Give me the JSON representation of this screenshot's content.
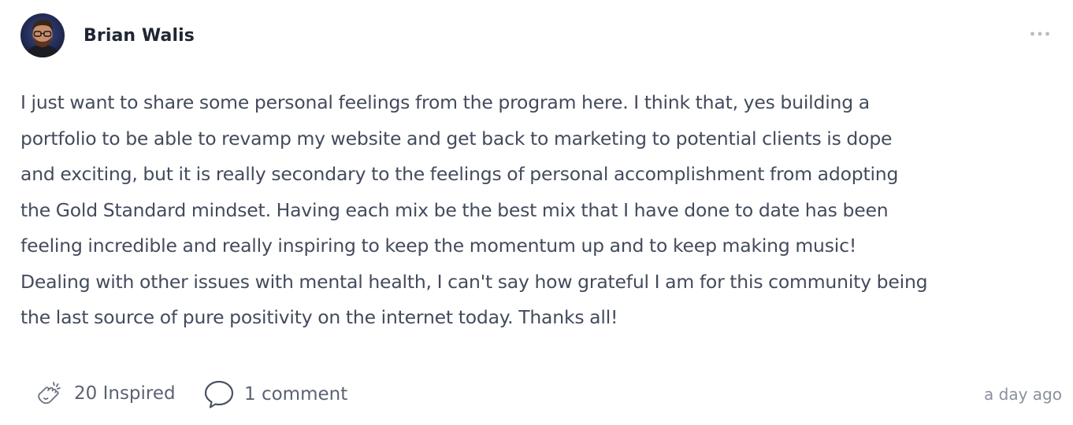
{
  "post": {
    "author": {
      "name": "Brian Walis",
      "avatar_icon": "user-avatar-photo"
    },
    "menu_icon": "more-horizontal-icon",
    "body_lines": [
      "I just want to share some personal feelings from the program here. I think that, yes building a",
      "portfolio to be able to revamp my website and get back to marketing to potential clients is dope",
      "and exciting, but it is really secondary to the feelings of personal accomplishment from adopting",
      "the Gold Standard mindset. Having each mix be the best mix that I have done to date has been",
      "feeling incredible and really inspiring to keep the momentum up and to keep making music!",
      "Dealing with other issues with mental health, I can't say how grateful I am for this community being",
      "the last source of pure positivity on the internet today. Thanks all!"
    ],
    "reaction": {
      "icon": "clapping-hands-icon",
      "label": "20 Inspired"
    },
    "comments": {
      "icon": "speech-bubble-icon",
      "label": "1 comment"
    },
    "timestamp": "a day ago"
  }
}
